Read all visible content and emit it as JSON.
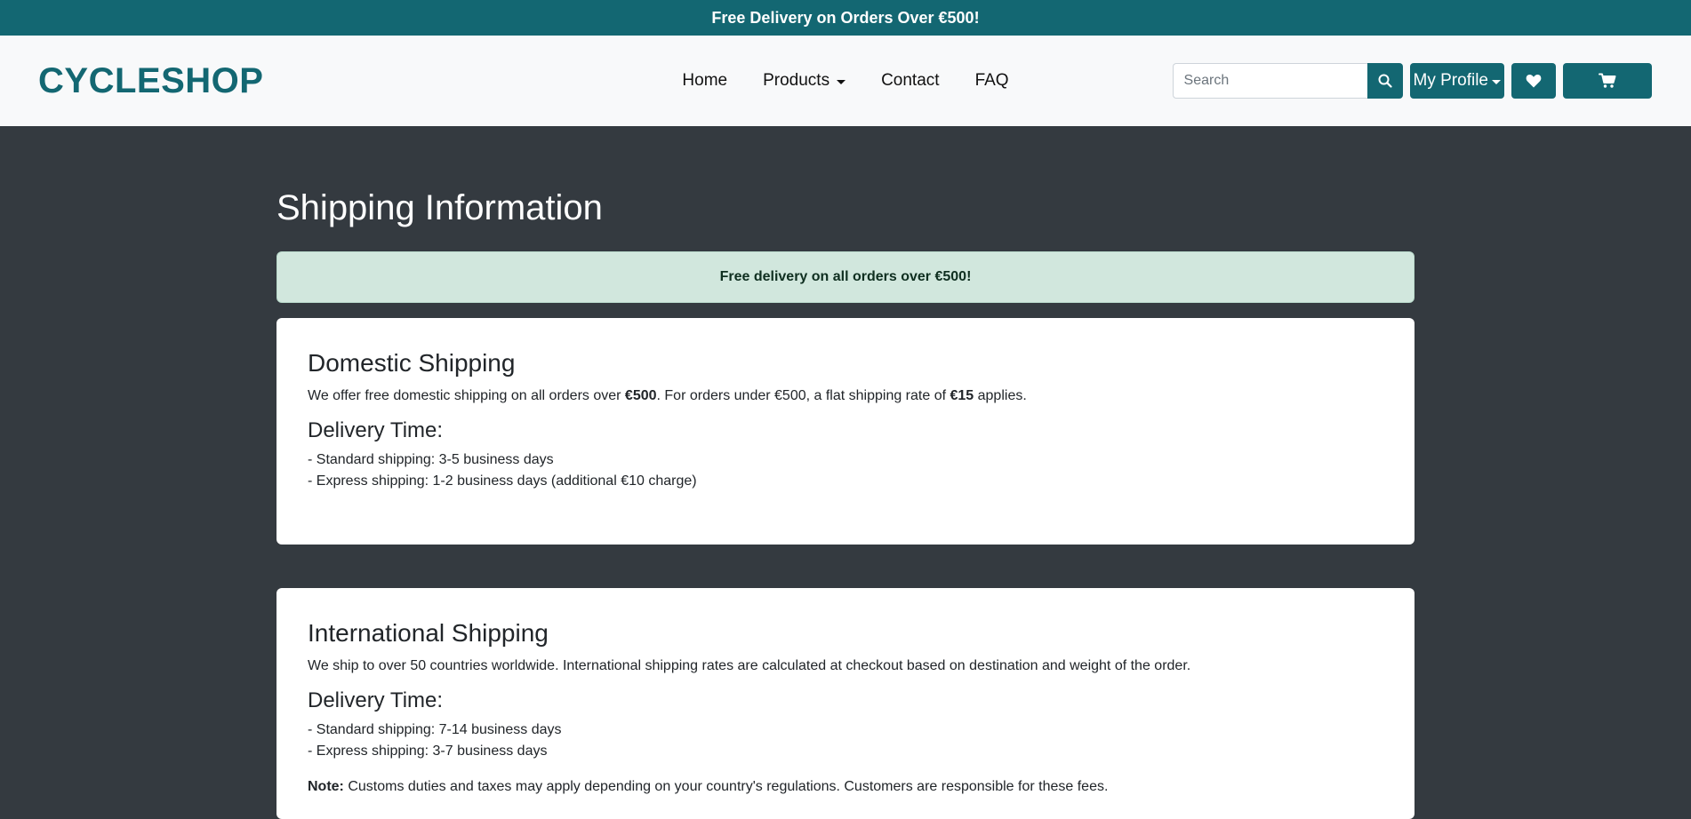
{
  "promo": {
    "text": "Free Delivery on Orders Over €500!"
  },
  "nav": {
    "brand": "CYCLESHOP",
    "links": {
      "home": "Home",
      "products": "Products",
      "contact": "Contact",
      "faq": "FAQ"
    },
    "search_placeholder": "Search",
    "profile_label": "My Profile"
  },
  "page": {
    "title": "Shipping Information",
    "alert": "Free delivery on all orders over €500!"
  },
  "domestic": {
    "heading": "Domestic Shipping",
    "text_1": "We offer free domestic shipping on all orders over ",
    "bold_1": "€500",
    "text_2": ". For orders under €500, a flat shipping rate of ",
    "bold_2": "€15",
    "text_3": " applies.",
    "delivery_heading": "Delivery Time:",
    "delivery_items": [
      "- Standard shipping: 3-5 business days",
      "- Express shipping: 1-2 business days (additional €10 charge)"
    ]
  },
  "international": {
    "heading": "International Shipping",
    "text": "We ship to over 50 countries worldwide. International shipping rates are calculated at checkout based on destination and weight of the order.",
    "delivery_heading": "Delivery Time:",
    "delivery_items": [
      "- Standard shipping: 7-14 business days",
      "- Express shipping: 3-7 business days"
    ],
    "note_label": "Note:",
    "note_text": " Customs duties and taxes may apply depending on your country's regulations. Customers are responsible for these fees."
  },
  "colors": {
    "brand": "#136772",
    "page_bg": "#343a40",
    "alert_bg": "#d1e7dd",
    "navbar_bg": "#f8f9fa"
  },
  "icons": {
    "search": "search-icon",
    "favorites": "heart-icon",
    "cart": "cart-icon"
  }
}
